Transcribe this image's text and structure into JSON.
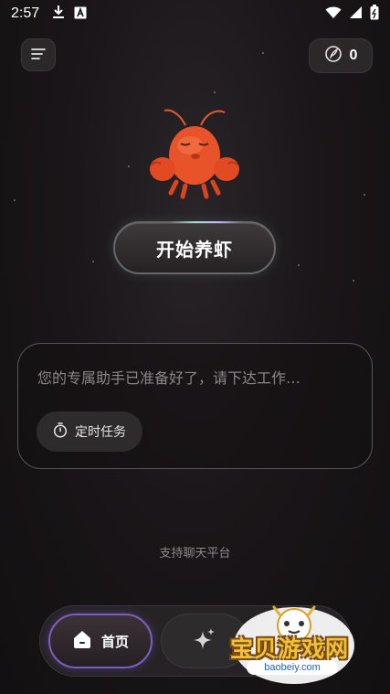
{
  "status_bar": {
    "time": "2:57",
    "icons_left": [
      "download-icon",
      "font-a-icon"
    ],
    "icons_right": [
      "wifi-icon",
      "signal-icon",
      "battery-icon"
    ]
  },
  "header": {
    "menu_icon": "menu-lines-icon",
    "credits": {
      "icon": "feather-coin-icon",
      "value": "0"
    }
  },
  "hero": {
    "mascot": "lobster-mascot",
    "start_button_label": "开始养虾"
  },
  "input_card": {
    "placeholder": "您的专属助手已准备好了，请下达工作…",
    "timer_chip_label": "定时任务",
    "timer_icon": "timer-icon"
  },
  "footer_note": "支持聊天平台",
  "bottom_nav": {
    "items": [
      {
        "label": "首页",
        "icon": "home-icon",
        "active": true
      },
      {
        "label": "",
        "icon": "sparkle-icon",
        "active": false
      },
      {
        "label": "",
        "icon": "",
        "active": false
      }
    ]
  },
  "watermark": {
    "text": "宝贝游戏网",
    "domain": "baobeiy.com"
  },
  "colors": {
    "background": "#1a1619",
    "accent_purple": "#7a5fc0",
    "watermark_yellow": "#f0c23b"
  }
}
